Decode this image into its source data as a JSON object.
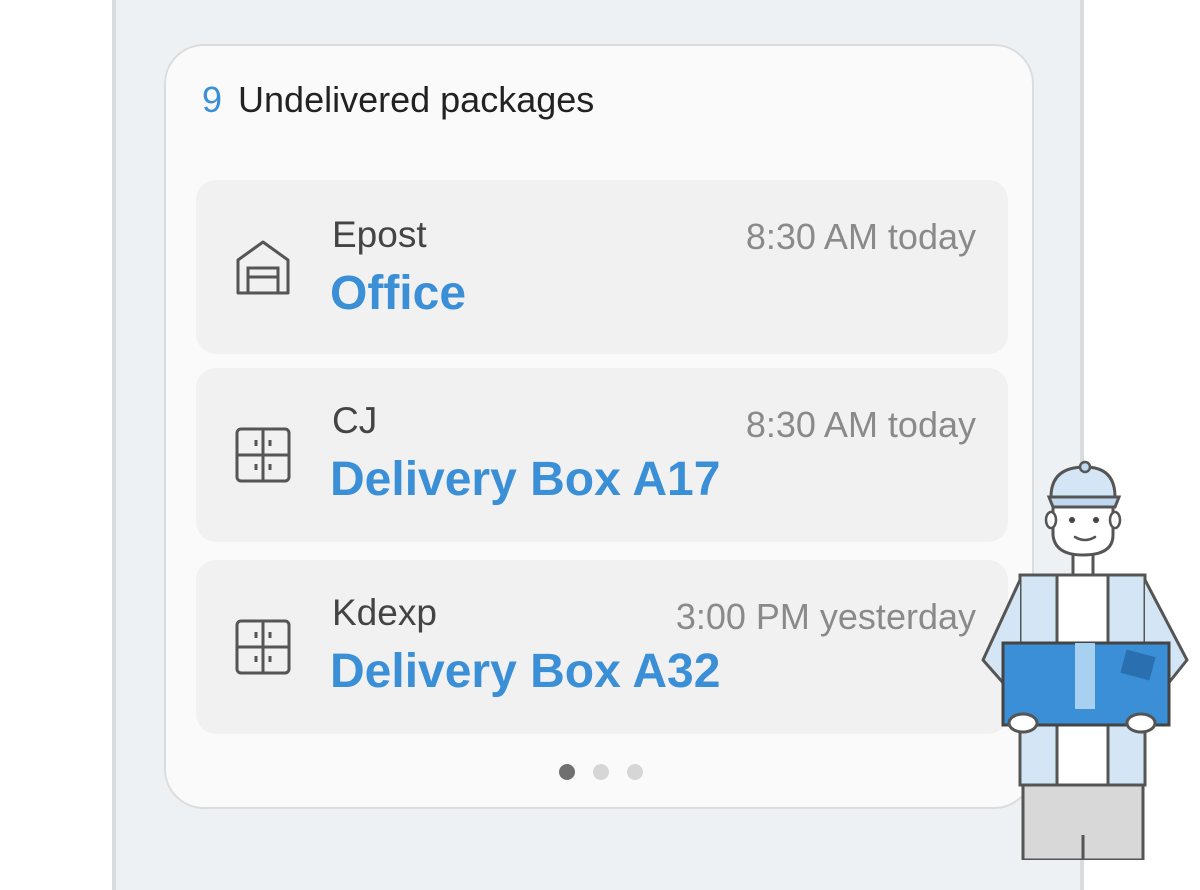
{
  "widget": {
    "count": "9",
    "title": "Undelivered packages",
    "packages": [
      {
        "carrier": "Epost",
        "time": "8:30 AM today",
        "location": "Office",
        "icon": "building-icon"
      },
      {
        "carrier": "CJ",
        "time": "8:30 AM today",
        "location": "Delivery Box A17",
        "icon": "locker-icon"
      },
      {
        "carrier": "Kdexp",
        "time": "3:00 PM yesterday",
        "location": "Delivery Box A32",
        "icon": "locker-icon"
      }
    ],
    "page_count": 3,
    "current_page": 1
  },
  "colors": {
    "accent": "#3a8fd6",
    "card_bg": "#fafafa",
    "row_bg": "#f1f1f1",
    "screen_bg": "#eef1f4"
  }
}
